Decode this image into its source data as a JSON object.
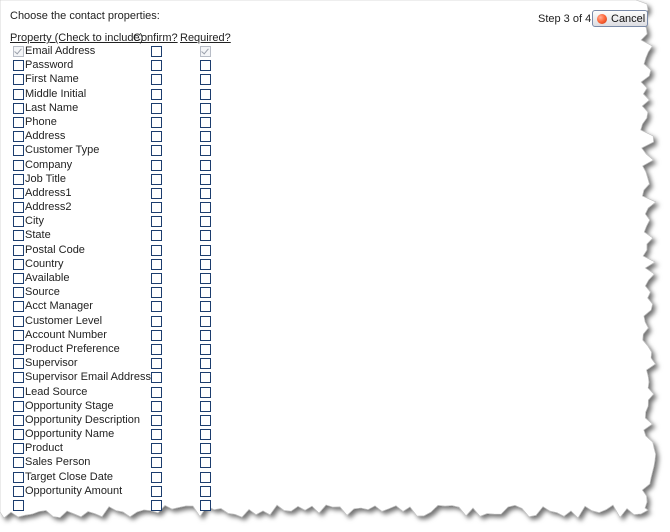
{
  "instruction": "Choose the contact properties:",
  "step_label": "Step 3 of 4",
  "cancel_label": "Cancel",
  "columns": {
    "property": "Property (Check to include)",
    "confirm": "Confirm?",
    "required": "Required?"
  },
  "properties": [
    {
      "label": "Email Address",
      "include": true,
      "confirm": false,
      "required": true,
      "locked": true
    },
    {
      "label": "Password",
      "include": false,
      "confirm": false,
      "required": false
    },
    {
      "label": "First Name",
      "include": false,
      "confirm": false,
      "required": false
    },
    {
      "label": "Middle Initial",
      "include": false,
      "confirm": false,
      "required": false
    },
    {
      "label": "Last Name",
      "include": false,
      "confirm": false,
      "required": false
    },
    {
      "label": "Phone",
      "include": false,
      "confirm": false,
      "required": false
    },
    {
      "label": "Address",
      "include": false,
      "confirm": false,
      "required": false
    },
    {
      "label": "Customer Type",
      "include": false,
      "confirm": false,
      "required": false
    },
    {
      "label": "Company",
      "include": false,
      "confirm": false,
      "required": false
    },
    {
      "label": "Job Title",
      "include": false,
      "confirm": false,
      "required": false
    },
    {
      "label": "Address1",
      "include": false,
      "confirm": false,
      "required": false
    },
    {
      "label": "Address2",
      "include": false,
      "confirm": false,
      "required": false
    },
    {
      "label": "City",
      "include": false,
      "confirm": false,
      "required": false
    },
    {
      "label": "State",
      "include": false,
      "confirm": false,
      "required": false
    },
    {
      "label": "Postal Code",
      "include": false,
      "confirm": false,
      "required": false
    },
    {
      "label": "Country",
      "include": false,
      "confirm": false,
      "required": false
    },
    {
      "label": "Available",
      "include": false,
      "confirm": false,
      "required": false
    },
    {
      "label": "Source",
      "include": false,
      "confirm": false,
      "required": false
    },
    {
      "label": "Acct Manager",
      "include": false,
      "confirm": false,
      "required": false
    },
    {
      "label": "Customer Level",
      "include": false,
      "confirm": false,
      "required": false
    },
    {
      "label": "Account Number",
      "include": false,
      "confirm": false,
      "required": false
    },
    {
      "label": "Product Preference",
      "include": false,
      "confirm": false,
      "required": false
    },
    {
      "label": "Supervisor",
      "include": false,
      "confirm": false,
      "required": false
    },
    {
      "label": "Supervisor Email Address",
      "include": false,
      "confirm": false,
      "required": false
    },
    {
      "label": "Lead Source",
      "include": false,
      "confirm": false,
      "required": false
    },
    {
      "label": "Opportunity Stage",
      "include": false,
      "confirm": false,
      "required": false
    },
    {
      "label": "Opportunity Description",
      "include": false,
      "confirm": false,
      "required": false
    },
    {
      "label": "Opportunity Name",
      "include": false,
      "confirm": false,
      "required": false
    },
    {
      "label": "Product",
      "include": false,
      "confirm": false,
      "required": false
    },
    {
      "label": "Sales Person",
      "include": false,
      "confirm": false,
      "required": false
    },
    {
      "label": "Target Close Date",
      "include": false,
      "confirm": false,
      "required": false
    },
    {
      "label": "Opportunity Amount",
      "include": false,
      "confirm": false,
      "required": false
    },
    {
      "label": "",
      "include": false,
      "confirm": false,
      "required": false
    }
  ],
  "colors": {
    "checkbox_border": "#1c3d6e",
    "checkbox_disabled": "#b7bcc6",
    "cancel_icon": "#ff6a3d"
  }
}
